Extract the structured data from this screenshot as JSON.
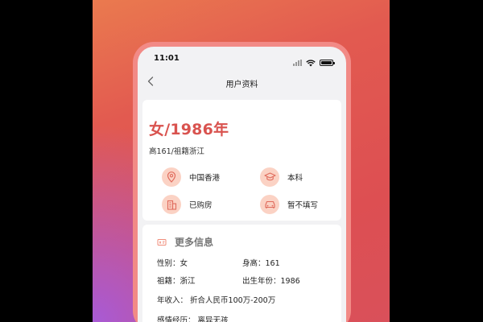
{
  "status_bar": {
    "time": "11:01"
  },
  "nav": {
    "title": "用户资料"
  },
  "profile": {
    "headline": "女/1986年",
    "subline": "高161/祖籍浙江",
    "tags": [
      {
        "icon": "location-pin-icon",
        "label": "中国香港"
      },
      {
        "icon": "graduation-cap-icon",
        "label": "本科"
      },
      {
        "icon": "building-icon",
        "label": "已购房"
      },
      {
        "icon": "car-icon",
        "label": "暂不填写"
      }
    ]
  },
  "more_info": {
    "title": "更多信息",
    "gender": "性别：女",
    "height": "身高：161",
    "origin": "祖籍：浙江",
    "birth_year": "出生年份：1986",
    "income": "年收入：  折合人民币100万-200万",
    "relationship": "感情经历：  离异无孩"
  },
  "colors": {
    "accent": "#d9534f",
    "tag_bg": "#fbd2c4",
    "phone_frame": "#f28a86"
  }
}
